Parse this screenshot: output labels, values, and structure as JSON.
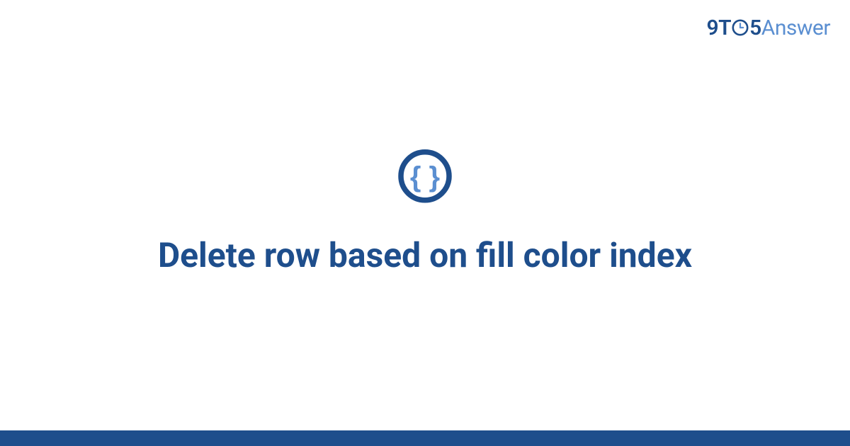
{
  "brand": {
    "part1": "9",
    "part2": "T",
    "part3": "5",
    "part4": "Answer"
  },
  "icon": {
    "name": "code-braces-icon"
  },
  "title": "Delete row based on fill color index",
  "colors": {
    "primary": "#1e4e8c",
    "accent": "#5b8fd1"
  }
}
